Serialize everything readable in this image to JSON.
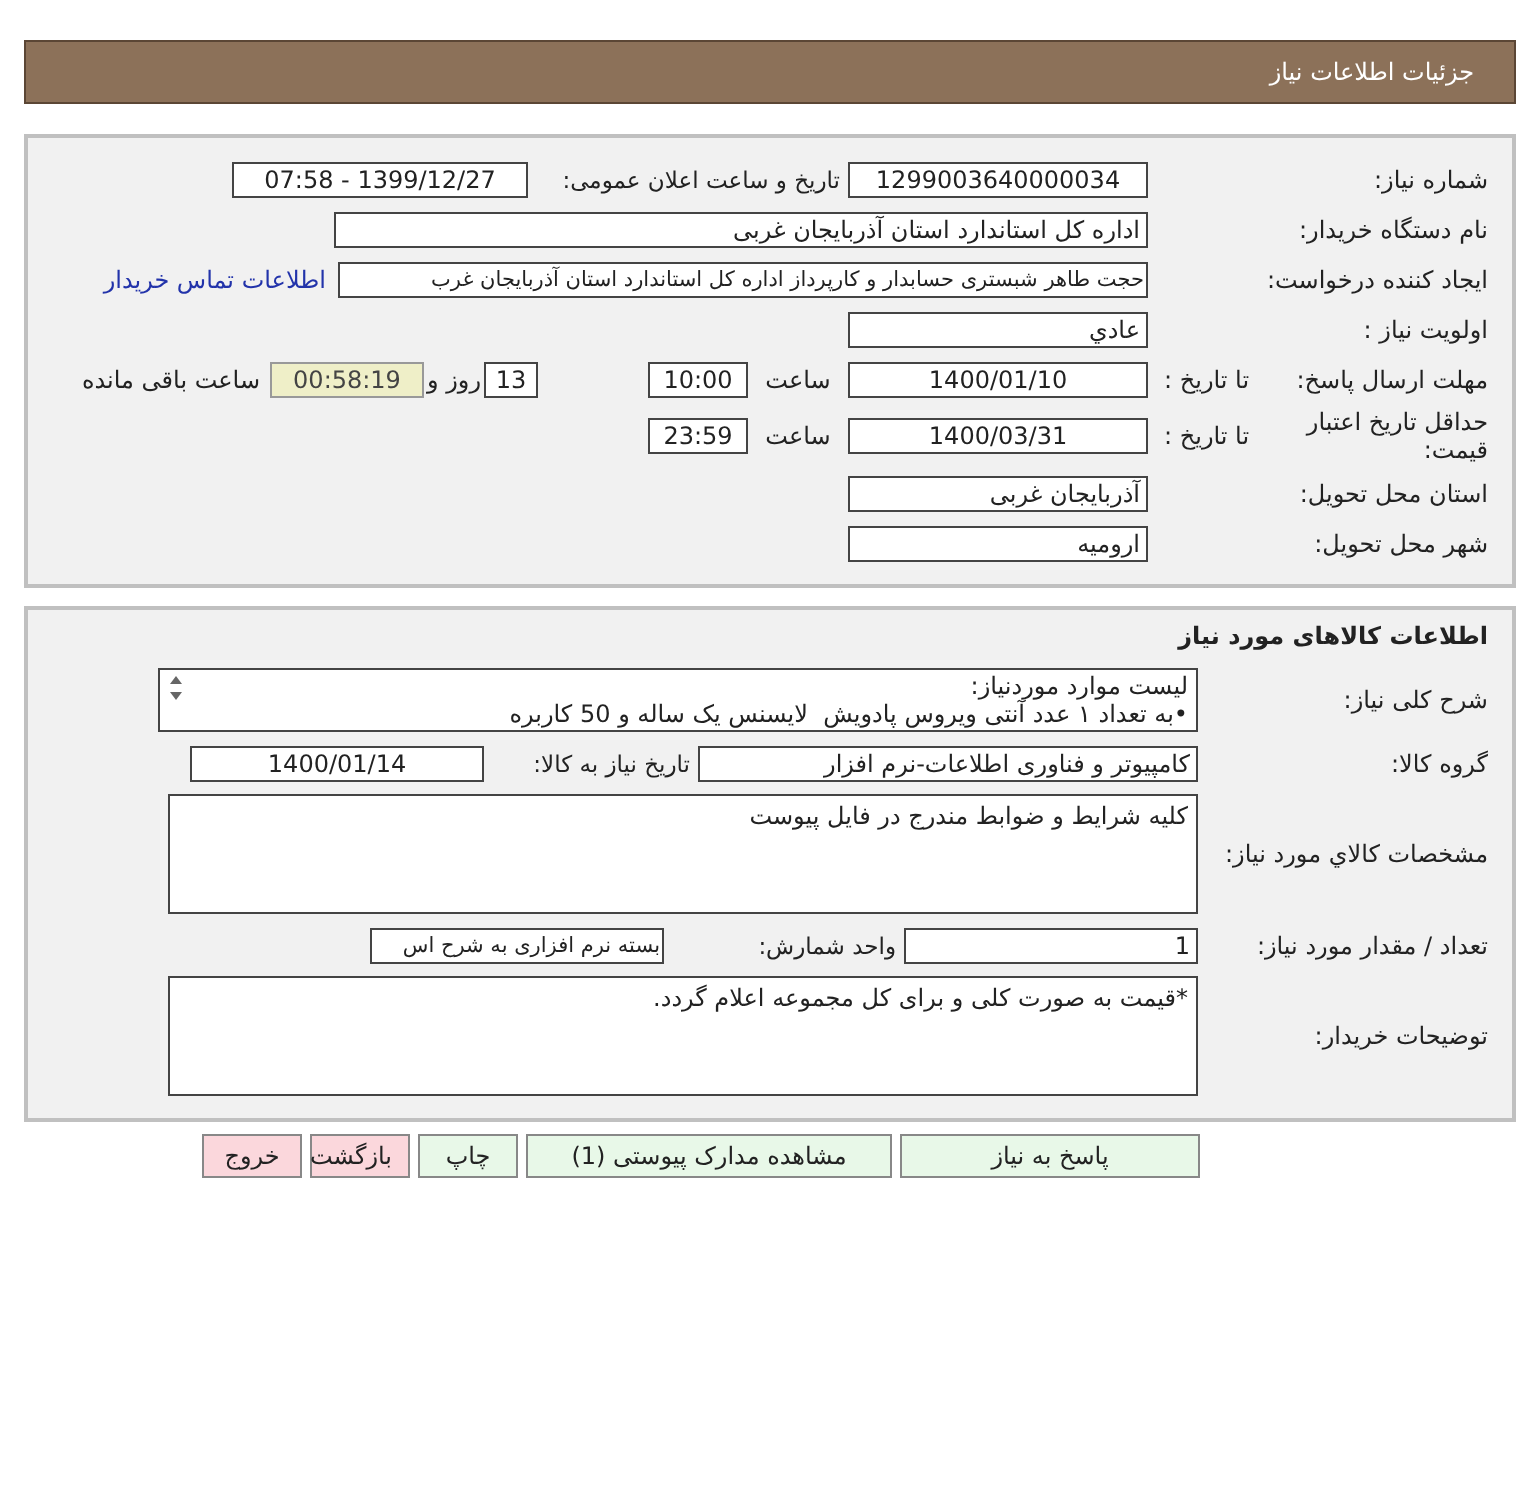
{
  "header": {
    "title": "جزئیات اطلاعات نیاز"
  },
  "need_info": {
    "need_number": {
      "label": "شماره نیاز:",
      "value": "1299003640000034"
    },
    "announce_date": {
      "label": "تاریخ و ساعت اعلان عمومی:",
      "value": "1399/12/27 - 07:58"
    },
    "buyer_org": {
      "label": "نام دستگاه خریدار:",
      "value": "اداره کل استاندارد استان آذربایجان غربی"
    },
    "requester": {
      "label": "ایجاد کننده درخواست:",
      "value": "حجت طاهر شبستری حسابدار و کارپرداز اداره کل استاندارد استان آذربایجان غرب",
      "contact_link": "اطلاعات تماس خریدار"
    },
    "priority": {
      "label": "اولویت نیاز :",
      "value": "عادي"
    },
    "response_deadline": {
      "label": "مهلت ارسال پاسخ:",
      "sub_label": "تا تاریخ :",
      "date": "1400/01/10",
      "time_label": "ساعت",
      "time": "10:00",
      "days": "13",
      "days_label": "روز و",
      "remaining": "00:58:19",
      "remaining_label": "ساعت باقی مانده"
    },
    "price_validity": {
      "label": "حداقل تاریخ اعتبار قیمت:",
      "sub_label": "تا تاریخ :",
      "date": "1400/03/31",
      "time_label": "ساعت",
      "time": "23:59"
    },
    "delivery_province": {
      "label": "استان محل تحویل:",
      "value": "آذربایجان غربی"
    },
    "delivery_city": {
      "label": "شهر محل تحویل:",
      "value": "ارومیه"
    }
  },
  "goods_info": {
    "title": "اطلاعات کالاهای مورد نیاز",
    "description": {
      "label": "شرح کلی نیاز:",
      "lines": [
        "لیست موارد موردنیاز:",
        "•به تعداد ۱ عدد آنتی ویروس پادویش  لایسنس یک ساله و 50 کاربره"
      ]
    },
    "goods_group": {
      "label": "گروه کالا:",
      "value": "کامپیوتر و فناوری اطلاعات-نرم افزار"
    },
    "need_date": {
      "label": "تاریخ نیاز به کالا:",
      "value": "1400/01/14"
    },
    "specs": {
      "label": "مشخصات کالاي مورد نیاز:",
      "value": "کلیه شرایط و ضوابط مندرج در فایل پیوست"
    },
    "quantity": {
      "label": "تعداد / مقدار مورد نیاز:",
      "value": "1"
    },
    "unit": {
      "label": "واحد شمارش:",
      "value": "بسته نرم افزاری به شرح اس"
    },
    "buyer_notes": {
      "label": "توضیحات خریدار:",
      "value": "*قیمت به صورت کلی و برای کل مجموعه اعلام گردد."
    }
  },
  "buttons": [
    {
      "label": "پاسخ به نیاز",
      "color": "#e8f8e8"
    },
    {
      "label": "مشاهده مدارک پیوستی (1)",
      "color": "#e8f8e8"
    },
    {
      "label": "چاپ",
      "color": "#e8f8e8"
    },
    {
      "label": "بازگشت",
      "color": "#fbd7dc"
    },
    {
      "label": "خروج",
      "color": "#fbd7dc"
    }
  ]
}
